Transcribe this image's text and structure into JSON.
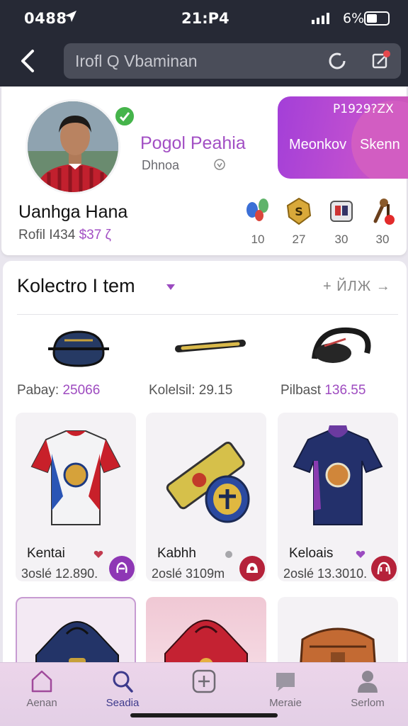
{
  "status_bar": {
    "time": "0488",
    "clock": "21:P4",
    "battery": "6%"
  },
  "header": {
    "search_text": "Irofl Q Vbaminan"
  },
  "profile": {
    "club_name": "Pogol Peahia",
    "club_sub": "Dhnoa",
    "user_name": "Uanhga Hana",
    "meta_prefix": "Rofil I434",
    "meta_highlight": "$37 ζ",
    "promo": {
      "code": "P1929?ZX",
      "left_label": "Meonkov",
      "right_label": "Skenn"
    },
    "stats": [
      "10",
      "27",
      "30",
      "30"
    ]
  },
  "collection": {
    "title": "Kolectro I tem",
    "more": "+ ЙЛЖ →",
    "mini_items": [
      {
        "prefix": "Pabay:",
        "value": "25066"
      },
      {
        "prefix": "Kolelsil: 29.15",
        "value": ""
      },
      {
        "prefix": "Pilbast",
        "value": "136.55"
      }
    ],
    "items": [
      {
        "name": "Kentai",
        "price": "3oslé 12.890."
      },
      {
        "name": "Kabhh",
        "price": "2oslé 3109m"
      },
      {
        "name": "Keloais",
        "price": "2oslé 13.3010."
      }
    ]
  },
  "bottom_nav": [
    {
      "label": "Aenan"
    },
    {
      "label": "Seadia"
    },
    {
      "label": ""
    },
    {
      "label": "Meraie"
    },
    {
      "label": "Serlom"
    }
  ],
  "colors": {
    "accent": "#a24fc4",
    "header": "#262935",
    "promo": "#b445d8",
    "nav": "#e8d3e9"
  }
}
